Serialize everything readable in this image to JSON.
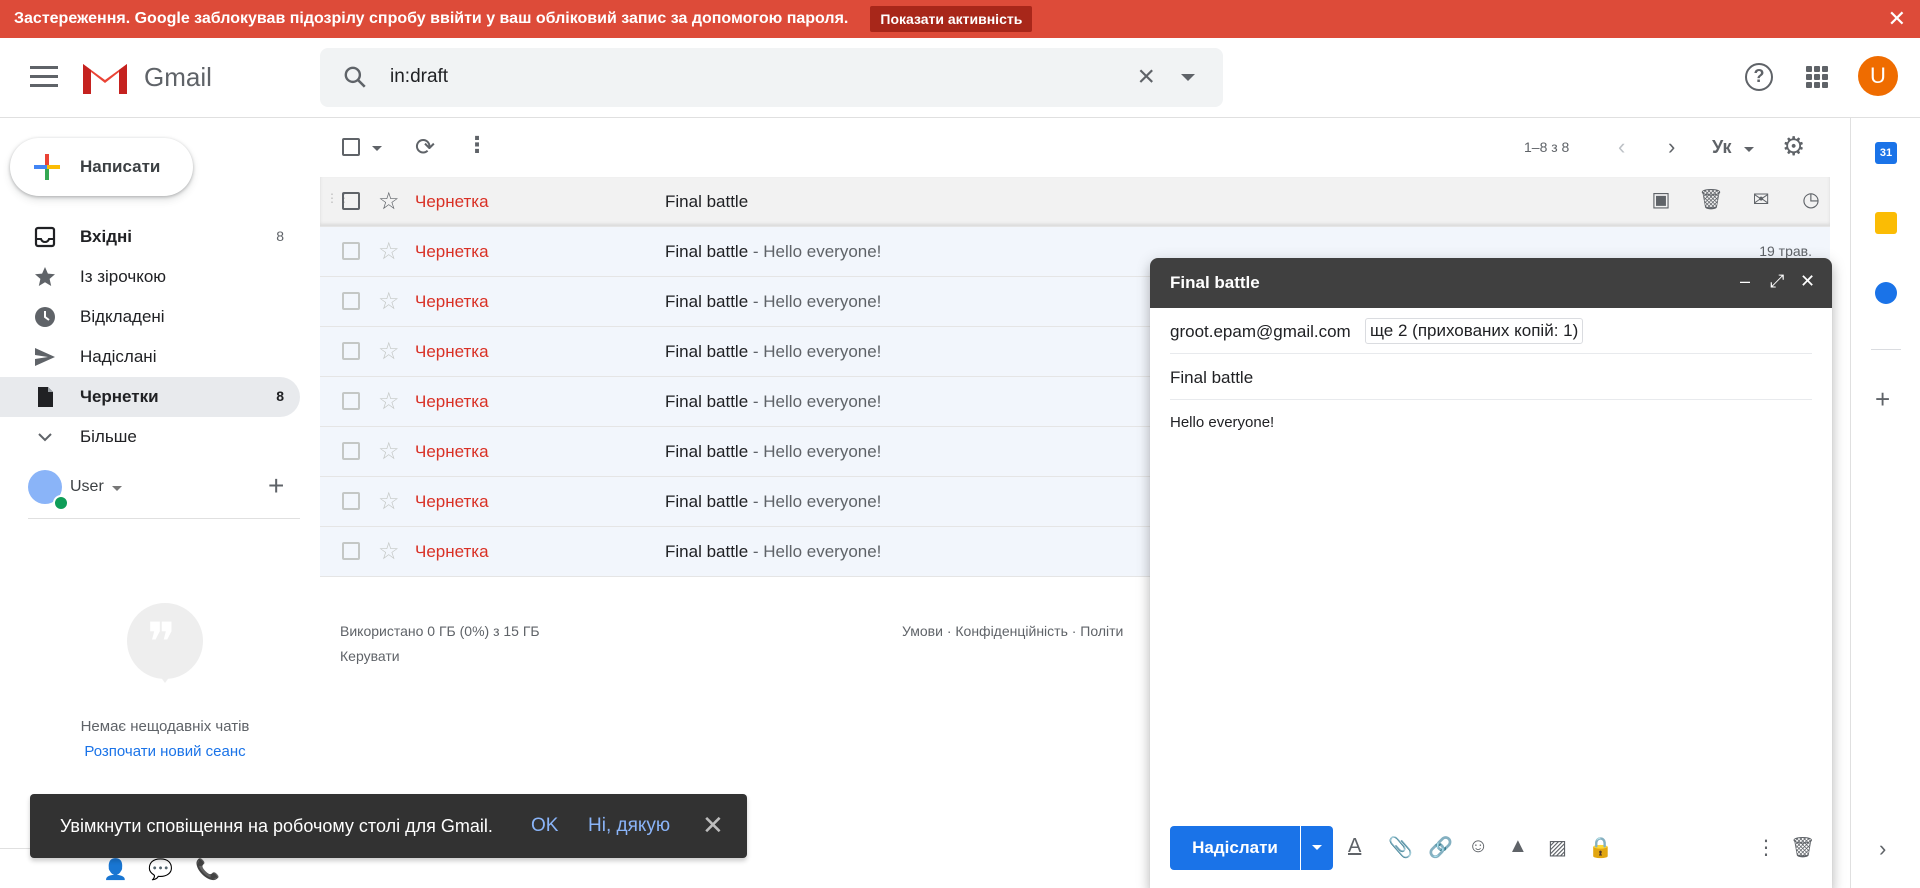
{
  "warning": {
    "text": "Застереження. Google заблокував підозрілу спробу ввійти у ваш обліковий запис за допомогою пароля.",
    "button": "Показати активність",
    "close": "✕",
    "color": "#dd4b39"
  },
  "header": {
    "logo_text": "Gmail",
    "search_value": "in:draft",
    "help": "?",
    "avatar_letter": "U",
    "avatar_color": "#ef6c00"
  },
  "sidebar": {
    "compose_label": "Написати",
    "items": [
      {
        "label": "Вхідні",
        "count": "8",
        "icon": "inbox-icon"
      },
      {
        "label": "Із зірочкою",
        "count": "",
        "icon": "star-icon"
      },
      {
        "label": "Відкладені",
        "count": "",
        "icon": "clock-icon"
      },
      {
        "label": "Надіслані",
        "count": "",
        "icon": "send-icon"
      },
      {
        "label": "Чернетки",
        "count": "8",
        "icon": "draft-icon"
      },
      {
        "label": "Більше",
        "count": "",
        "icon": "chevron-down-icon"
      }
    ],
    "user_name": "User",
    "no_chats": "Немає нещодавніх чатів",
    "new_chat": "Розпочати новий сеанс"
  },
  "toolbar": {
    "range": "1–8 з 8",
    "lang": "Ук"
  },
  "list": {
    "rows": [
      {
        "sender": "Чернетка",
        "subject": "Final battle",
        "snippet": "",
        "date": ""
      },
      {
        "sender": "Чернетка",
        "subject": "Final battle",
        "snippet": " - Hello everyone!",
        "date": "19 трав."
      },
      {
        "sender": "Чернетка",
        "subject": "Final battle",
        "snippet": " - Hello everyone!",
        "date": ""
      },
      {
        "sender": "Чернетка",
        "subject": "Final battle",
        "snippet": " - Hello everyone!",
        "date": ""
      },
      {
        "sender": "Чернетка",
        "subject": "Final battle",
        "snippet": " - Hello everyone!",
        "date": ""
      },
      {
        "sender": "Чернетка",
        "subject": "Final battle",
        "snippet": " - Hello everyone!",
        "date": ""
      },
      {
        "sender": "Чернетка",
        "subject": "Final battle",
        "snippet": " - Hello everyone!",
        "date": ""
      },
      {
        "sender": "Чернетка",
        "subject": "Final battle",
        "snippet": " - Hello everyone!",
        "date": ""
      }
    ]
  },
  "footer": {
    "used": "Використано 0 ГБ (0%) з 15 ГБ",
    "manage": "Керувати",
    "terms": "Умови · Конфіденційність · Політи"
  },
  "rail": {
    "calendar_label": "31"
  },
  "compose": {
    "title": "Final battle",
    "to": "groot.epam@gmail.com",
    "more_recipients": "ще 2 (прихованих копій: 1)",
    "subject": "Final battle",
    "body": "Hello everyone!",
    "send_label": "Надіслати"
  },
  "snackbar": {
    "message": "Увімкнути сповіщення на робочому столі для Gmail.",
    "ok": "OK",
    "no": "Ні, дякую",
    "close": "✕"
  }
}
